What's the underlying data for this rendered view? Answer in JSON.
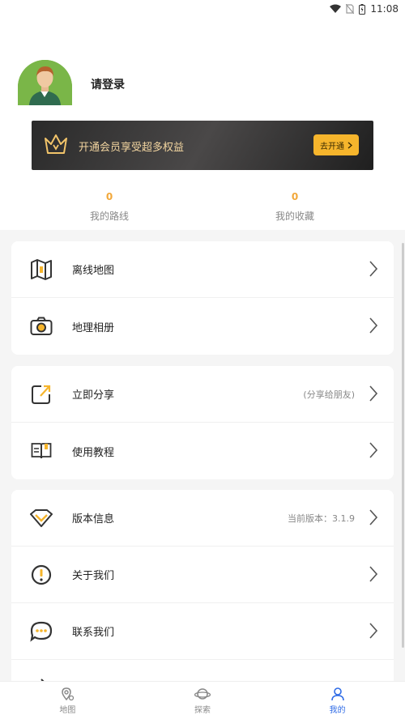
{
  "status_bar": {
    "time": "11:08"
  },
  "profile": {
    "login_text": "请登录"
  },
  "vip": {
    "text": "开通会员享受超多权益",
    "button_label": "去开通"
  },
  "stats": [
    {
      "value": "0",
      "label": "我的路线"
    },
    {
      "value": "0",
      "label": "我的收藏"
    }
  ],
  "menu": {
    "offline_map": "离线地图",
    "geo_album": "地理相册",
    "share": "立即分享",
    "share_hint": "(分享给朋友)",
    "tutorial": "使用教程",
    "version": "版本信息",
    "version_hint": "当前版本：3.1.9",
    "about": "关于我们",
    "contact": "联系我们"
  },
  "bottom_nav": [
    {
      "label": "地图",
      "icon": "map-pin-icon"
    },
    {
      "label": "探索",
      "icon": "planet-icon"
    },
    {
      "label": "我的",
      "icon": "user-icon"
    }
  ],
  "colors": {
    "accent_blue": "#2f6be6",
    "gold": "#f6b52c",
    "stat_orange": "#f2a83a"
  }
}
